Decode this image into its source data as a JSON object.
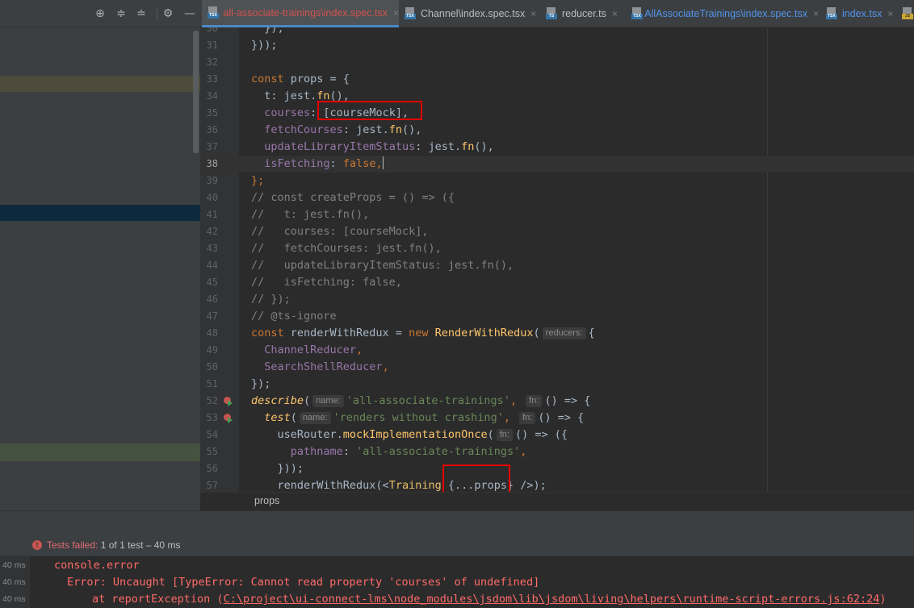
{
  "left_toolbar": {
    "icons": [
      "crosshair-icon",
      "expand-all-icon",
      "collapse-all-icon",
      "gear-icon",
      "minimize-icon"
    ],
    "glyphs": [
      "⊕",
      "≑",
      "≐",
      "⚙",
      "—"
    ]
  },
  "tabs": [
    {
      "label": "all-associate-trainings\\index.spec.tsx",
      "icon": "tsx-file-icon",
      "badge": "TSX",
      "active": true,
      "modified_color": "#d25252"
    },
    {
      "label": "Channel\\index.spec.tsx",
      "icon": "tsx-file-icon",
      "badge": "TSX"
    },
    {
      "label": "reducer.ts",
      "icon": "ts-file-icon",
      "badge": "TS"
    },
    {
      "label": "AllAssociateTrainings\\index.spec.tsx",
      "icon": "tsx-file-icon",
      "badge": "TSX",
      "link_color": "#5394ec"
    },
    {
      "label": "index.tsx",
      "icon": "tsx-file-icon",
      "badge": "TSX",
      "link_color": "#5394ec"
    },
    {
      "label": "",
      "icon": "js-file-icon",
      "badge": "JS"
    }
  ],
  "tab_close_glyph": "×",
  "editor": {
    "current_line": 38,
    "lines": [
      {
        "n": "30",
        "tokens": [
          [
            "  });",
            ""
          ]
        ]
      },
      {
        "n": "31",
        "tokens": [
          [
            "}));",
            ""
          ]
        ]
      },
      {
        "n": "32",
        "tokens": []
      },
      {
        "n": "33",
        "tokens": [
          [
            "const",
            "kw"
          ],
          [
            " props = {",
            ""
          ]
        ]
      },
      {
        "n": "34",
        "tokens": [
          [
            "  t: jest.",
            ""
          ],
          [
            "fn",
            "fn"
          ],
          [
            "(),",
            ""
          ]
        ]
      },
      {
        "n": "35",
        "tokens": [
          [
            "  ",
            ""
          ],
          [
            "courses",
            "prop"
          ],
          [
            ": [courseMock],",
            ""
          ]
        ]
      },
      {
        "n": "36",
        "tokens": [
          [
            "  ",
            ""
          ],
          [
            "fetchCourses",
            "prop"
          ],
          [
            ": jest.",
            ""
          ],
          [
            "fn",
            "fn"
          ],
          [
            "(),",
            ""
          ]
        ]
      },
      {
        "n": "37",
        "tokens": [
          [
            "  ",
            ""
          ],
          [
            "updateLibraryItemStatus",
            "prop"
          ],
          [
            ": jest.",
            ""
          ],
          [
            "fn",
            "fn"
          ],
          [
            "(),",
            ""
          ]
        ]
      },
      {
        "n": "38",
        "tokens": [
          [
            "  ",
            ""
          ],
          [
            "isFetching",
            "prop"
          ],
          [
            ": ",
            ""
          ],
          [
            "false",
            "kw"
          ],
          [
            ",",
            "kw"
          ],
          [
            "|caret|",
            "caret"
          ]
        ]
      },
      {
        "n": "39",
        "tokens": [
          [
            "};",
            "kw"
          ]
        ]
      },
      {
        "n": "40",
        "tokens": [
          [
            "// const createProps = () => ({",
            "cmt"
          ]
        ]
      },
      {
        "n": "41",
        "tokens": [
          [
            "//   t: jest.fn(),",
            "cmt"
          ]
        ]
      },
      {
        "n": "42",
        "tokens": [
          [
            "//   courses: [courseMock],",
            "cmt"
          ]
        ]
      },
      {
        "n": "43",
        "tokens": [
          [
            "//   fetchCourses: jest.fn(),",
            "cmt"
          ]
        ]
      },
      {
        "n": "44",
        "tokens": [
          [
            "//   updateLibraryItemStatus: jest.fn(),",
            "cmt"
          ]
        ]
      },
      {
        "n": "45",
        "tokens": [
          [
            "//   isFetching: false,",
            "cmt"
          ]
        ]
      },
      {
        "n": "46",
        "tokens": [
          [
            "// });",
            "cmt"
          ]
        ]
      },
      {
        "n": "47",
        "tokens": [
          [
            "// @ts-ignore",
            "cmt"
          ]
        ]
      },
      {
        "n": "48",
        "tokens": [
          [
            "const",
            "kw"
          ],
          [
            " renderWithRedux = ",
            ""
          ],
          [
            "new",
            "kw"
          ],
          [
            " ",
            ""
          ],
          [
            "RenderWithRedux",
            "fn"
          ],
          [
            "(",
            ""
          ],
          [
            "reducers:",
            "hint"
          ],
          [
            "{",
            ""
          ]
        ]
      },
      {
        "n": "49",
        "tokens": [
          [
            "  ",
            ""
          ],
          [
            "ChannelReducer",
            "prop"
          ],
          [
            ",",
            "kw"
          ]
        ]
      },
      {
        "n": "50",
        "tokens": [
          [
            "  ",
            ""
          ],
          [
            "SearchShellReducer",
            "prop"
          ],
          [
            ",",
            "kw"
          ]
        ]
      },
      {
        "n": "51",
        "tokens": [
          [
            "});",
            ""
          ]
        ]
      },
      {
        "n": "52",
        "run": true,
        "tokens": [
          [
            "describe",
            "fni"
          ],
          [
            "(",
            ""
          ],
          [
            "name:",
            "hint"
          ],
          [
            "'all-associate-trainings'",
            "str"
          ],
          [
            ",",
            "kw"
          ],
          [
            " ",
            ""
          ],
          [
            "fn:",
            "hint"
          ],
          [
            "() => {",
            ""
          ]
        ]
      },
      {
        "n": "53",
        "run": true,
        "tokens": [
          [
            "  ",
            ""
          ],
          [
            "test",
            "fni"
          ],
          [
            "(",
            ""
          ],
          [
            "name:",
            "hint"
          ],
          [
            "'renders without crashing'",
            "str"
          ],
          [
            ",",
            "kw"
          ],
          [
            " ",
            ""
          ],
          [
            "fn:",
            "hint"
          ],
          [
            "() => {",
            ""
          ]
        ]
      },
      {
        "n": "54",
        "tokens": [
          [
            "    useRouter.",
            ""
          ],
          [
            "mockImplementationOnce",
            "fn"
          ],
          [
            "(",
            ""
          ],
          [
            "fn:",
            "hint"
          ],
          [
            "() => ({",
            ""
          ]
        ]
      },
      {
        "n": "55",
        "tokens": [
          [
            "      ",
            ""
          ],
          [
            "pathname",
            "prop"
          ],
          [
            ": ",
            ""
          ],
          [
            "'all-associate-trainings'",
            "str"
          ],
          [
            ",",
            "kw"
          ]
        ]
      },
      {
        "n": "56",
        "tokens": [
          [
            "    }));",
            ""
          ]
        ]
      },
      {
        "n": "57",
        "tokens": [
          [
            "    renderWithRedux(<",
            ""
          ],
          [
            "Training",
            "tag"
          ],
          [
            " {...props} />);",
            ""
          ]
        ]
      }
    ]
  },
  "breadcrumb": "props",
  "run": {
    "status_label": "Tests failed:",
    "status_detail": "1 of 1 test – 40 ms",
    "times": [
      "40 ms",
      "40 ms",
      "40 ms"
    ],
    "output": [
      {
        "text": "console.error",
        "indent": 67
      },
      {
        "text": "Error: Uncaught [TypeError: Cannot read property 'courses' of undefined]",
        "indent": 83
      },
      {
        "prefix": "at reportException (",
        "link": "C:\\project\\ui-connect-lms\\node_modules\\jsdom\\lib\\jsdom\\living\\helpers\\runtime-script-errors.js:62:24",
        "suffix": ")",
        "indent": 114
      }
    ]
  },
  "colors": {
    "accent": "#4a88c7",
    "error": "#ff6b68",
    "highlight_box": "#e30000"
  }
}
